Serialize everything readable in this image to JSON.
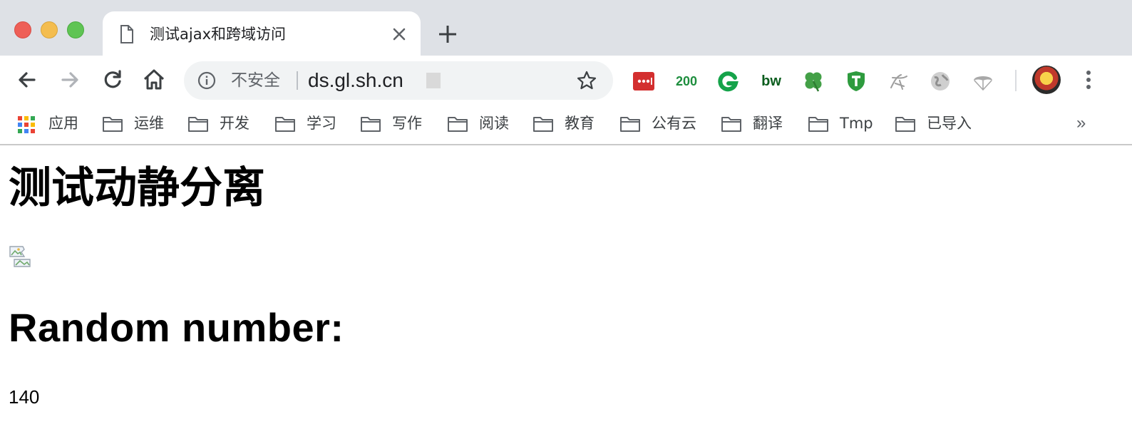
{
  "window": {
    "traffic_lights": [
      "close",
      "minimize",
      "maximize"
    ]
  },
  "tab": {
    "title": "测试ajax和跨域访问",
    "icon": "page-icon"
  },
  "toolbar": {
    "back_icon": "arrow-left-icon",
    "forward_icon": "arrow-right-icon",
    "reload_icon": "reload-icon",
    "home_icon": "home-icon",
    "security_label": "不安全",
    "url": "ds.gl.sh.cn",
    "extensions": [
      {
        "name": "lastpass-extension",
        "color": "#d32f2f"
      },
      {
        "name": "status-200-extension",
        "label": "200",
        "color": "#1e8e3e"
      },
      {
        "name": "grammarly-extension",
        "color": "#15c39a"
      },
      {
        "name": "bw-extension",
        "label": "bw",
        "color": "#1a7f37"
      },
      {
        "name": "clover-extension",
        "color": "#43a047"
      },
      {
        "name": "shield-extension",
        "color": "#2e7d32"
      },
      {
        "name": "sketch-extension",
        "color": "#9e9e9e"
      },
      {
        "name": "globe-extension",
        "color": "#9e9e9e"
      },
      {
        "name": "parachute-extension",
        "color": "#9e9e9e"
      }
    ]
  },
  "bookmarks": {
    "apps_label": "应用",
    "folders": [
      "运维",
      "开发",
      "学习",
      "写作",
      "阅读",
      "教育",
      "公有云",
      "翻译",
      "Tmp",
      "已导入"
    ],
    "more": "»"
  },
  "page": {
    "title": "测试动静分离",
    "random_heading": "Random number:",
    "random_value": "140"
  }
}
